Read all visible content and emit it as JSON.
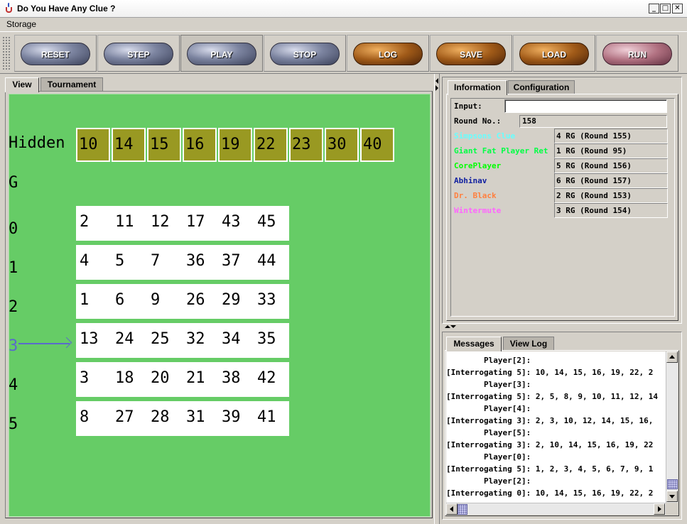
{
  "window": {
    "title": "Do You Have Any Clue ?"
  },
  "menu": {
    "items": [
      "Storage"
    ]
  },
  "toolbar": {
    "buttons": [
      {
        "label": "RESET",
        "style": "steel"
      },
      {
        "label": "STEP",
        "style": "steel"
      },
      {
        "label": "PLAY",
        "style": "steel"
      },
      {
        "label": "STOP",
        "style": "steel"
      },
      {
        "label": "LOG",
        "style": "wood"
      },
      {
        "label": "SAVE",
        "style": "wood"
      },
      {
        "label": "LOAD",
        "style": "wood"
      },
      {
        "label": "RUN",
        "style": "marble"
      }
    ],
    "active": "PLAY"
  },
  "left_tabs": [
    "View",
    "Tournament"
  ],
  "board": {
    "hidden_label": "Hidden",
    "hidden": [
      "10",
      "14",
      "15",
      "16",
      "19",
      "22",
      "23",
      "30",
      "40"
    ],
    "g_label": "G",
    "current_row": "3",
    "rows": [
      {
        "label": "0",
        "nums": [
          "2",
          "11",
          "12",
          "17",
          "43",
          "45"
        ]
      },
      {
        "label": "1",
        "nums": [
          "4",
          "5",
          "7",
          "36",
          "37",
          "44"
        ]
      },
      {
        "label": "2",
        "nums": [
          "1",
          "6",
          "9",
          "26",
          "29",
          "33"
        ]
      },
      {
        "label": "3",
        "nums": [
          "13",
          "24",
          "25",
          "32",
          "34",
          "35"
        ]
      },
      {
        "label": "4",
        "nums": [
          "3",
          "18",
          "20",
          "21",
          "38",
          "42"
        ]
      },
      {
        "label": "5",
        "nums": [
          "8",
          "27",
          "28",
          "31",
          "39",
          "41"
        ]
      }
    ],
    "colors": {
      "background": "#66cc66",
      "hidden_cell": "#999922",
      "row_cell": "#ffffff",
      "current_label": "#5a6acc"
    }
  },
  "info_tabs": [
    "Information",
    "Configuration"
  ],
  "info": {
    "input_label": "Input:",
    "input_value": "",
    "round_label": "Round No.:",
    "round_value": "158",
    "players": [
      {
        "name": "Simpsons Clue",
        "score": "4 RG (Round 155)",
        "color": "#66ffff"
      },
      {
        "name": "Giant Fat Player Ret",
        "score": "1 RG (Round 95)",
        "color": "#00ff44"
      },
      {
        "name": "CorePlayer",
        "score": "5 RG (Round 156)",
        "color": "#00ff00"
      },
      {
        "name": "Abhinav",
        "score": "6 RG (Round 157)",
        "color": "#1020a0"
      },
      {
        "name": "Dr. Black",
        "score": "2 RG (Round 153)",
        "color": "#ff8040"
      },
      {
        "name": "Wintermute",
        "score": "3 RG (Round 154)",
        "color": "#ff66ff"
      }
    ]
  },
  "msg_tabs": [
    "Messages",
    "View Log"
  ],
  "messages": [
    "        Player[2]:",
    "[Interrogating 5]: 10, 14, 15, 16, 19, 22, 2",
    "        Player[3]:",
    "[Interrogating 5]: 2, 5, 8, 9, 10, 11, 12, 14",
    "        Player[4]:",
    "[Interrogating 3]: 2, 3, 10, 12, 14, 15, 16,",
    "        Player[5]:",
    "[Interrogating 3]: 2, 10, 14, 15, 16, 19, 22",
    "        Player[0]:",
    "[Interrogating 5]: 1, 2, 3, 4, 5, 6, 7, 9, 1",
    "        Player[2]:",
    "[Interrogating 0]: 10, 14, 15, 16, 19, 22, 2"
  ]
}
